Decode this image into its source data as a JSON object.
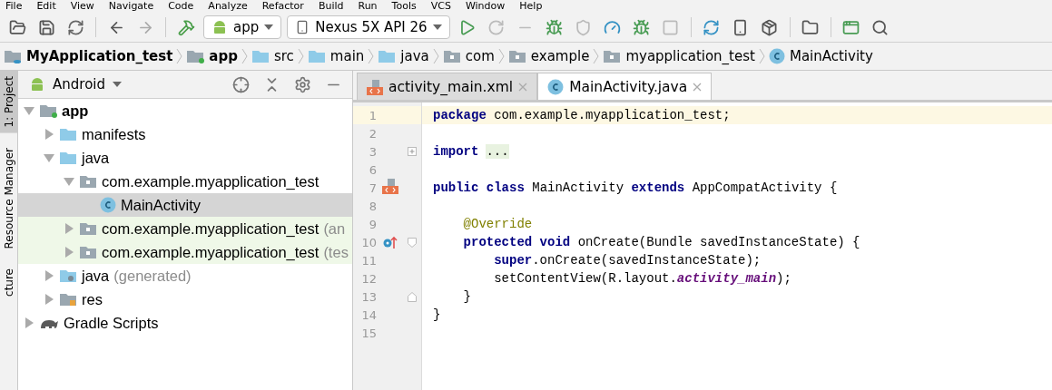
{
  "menu": [
    "File",
    "Edit",
    "View",
    "Navigate",
    "Code",
    "Analyze",
    "Refactor",
    "Build",
    "Run",
    "Tools",
    "VCS",
    "Window",
    "Help"
  ],
  "toolbar": {
    "config": "app",
    "device": "Nexus 5X API 26"
  },
  "breadcrumb": [
    {
      "label": "MyApplication_test",
      "kind": "project"
    },
    {
      "label": "app",
      "kind": "module"
    },
    {
      "label": "src",
      "kind": "folder"
    },
    {
      "label": "main",
      "kind": "folder"
    },
    {
      "label": "java",
      "kind": "source"
    },
    {
      "label": "com",
      "kind": "package"
    },
    {
      "label": "example",
      "kind": "package"
    },
    {
      "label": "myapplication_test",
      "kind": "package"
    },
    {
      "label": "MainActivity",
      "kind": "class"
    }
  ],
  "side_tabs": [
    {
      "label": "1: Project",
      "selected": true
    },
    {
      "label": "Resource Manager",
      "selected": false
    },
    {
      "label": "cture",
      "selected": false
    }
  ],
  "project_panel": {
    "view": "Android",
    "tree": [
      {
        "label": "app",
        "kind": "module",
        "expanded": true,
        "selected": false,
        "children": [
          {
            "label": "manifests",
            "kind": "folder",
            "expanded": false,
            "selected": false
          },
          {
            "label": "java",
            "kind": "folder",
            "expanded": true,
            "selected": false,
            "children": [
              {
                "label": "com.example.myapplication_test",
                "kind": "package",
                "expanded": true,
                "selected": false,
                "children": [
                  {
                    "label": "MainActivity",
                    "kind": "class",
                    "selected": true
                  }
                ]
              },
              {
                "label": "com.example.myapplication_test",
                "suffix": "(an",
                "kind": "package",
                "expanded": false,
                "selected": false,
                "test": true
              },
              {
                "label": "com.example.myapplication_test",
                "suffix": "(tes",
                "kind": "package",
                "expanded": false,
                "selected": false,
                "test": true
              }
            ]
          },
          {
            "label": "java",
            "suffix": "(generated)",
            "kind": "generated",
            "expanded": false,
            "selected": false
          },
          {
            "label": "res",
            "kind": "res",
            "expanded": false,
            "selected": false
          }
        ]
      },
      {
        "label": "Gradle Scripts",
        "kind": "gradle",
        "expanded": false,
        "selected": false
      }
    ]
  },
  "editor_tabs": [
    {
      "label": "activity_main.xml",
      "kind": "layout",
      "selected": false
    },
    {
      "label": "MainActivity.java",
      "kind": "class",
      "selected": true
    }
  ],
  "code": [
    {
      "number": "1",
      "current": true,
      "tokens": [
        {
          "text": "package",
          "kind": "keyword"
        },
        {
          "text": " com.example.myapplication_test;",
          "kind": "plain"
        }
      ]
    },
    {
      "number": "2",
      "current": false
    },
    {
      "number": "3",
      "current": false,
      "fold_collapsed": true,
      "tokens": [
        {
          "text": "import",
          "kind": "keyword"
        },
        {
          "text": "...",
          "kind": "folded"
        }
      ]
    },
    {
      "number": "6",
      "current": false
    },
    {
      "number": "7",
      "current": false,
      "layout_marker": true,
      "tokens": [
        {
          "text": "public class",
          "kind": "keyword"
        },
        {
          "text": " MainActivity ",
          "kind": "plain"
        },
        {
          "text": "extends",
          "kind": "keyword"
        },
        {
          "text": " AppCompatActivity {",
          "kind": "plain"
        }
      ]
    },
    {
      "number": "8",
      "current": false
    },
    {
      "number": "9",
      "current": false,
      "tokens": [
        {
          "text": "    @Override",
          "kind": "annotation"
        }
      ]
    },
    {
      "number": "10",
      "current": false,
      "override_marker": true,
      "fold_start": true,
      "tokens": [
        {
          "text": "    protected void",
          "kind": "keyword"
        },
        {
          "text": " onCreate(Bundle savedInstanceState) {",
          "kind": "plain"
        }
      ]
    },
    {
      "number": "11",
      "current": false,
      "tokens": [
        {
          "text": "        super",
          "kind": "keyword"
        },
        {
          "text": ".onCreate(savedInstanceState);",
          "kind": "plain"
        }
      ]
    },
    {
      "number": "12",
      "current": false,
      "tokens": [
        {
          "text": "        setContentView(R.layout.",
          "kind": "plain"
        },
        {
          "text": "activity_main",
          "kind": "field"
        },
        {
          "text": ");",
          "kind": "plain"
        }
      ]
    },
    {
      "number": "13",
      "current": false,
      "fold_end": true,
      "tokens": [
        {
          "text": "    }",
          "kind": "plain"
        }
      ]
    },
    {
      "number": "14",
      "current": false,
      "tokens": [
        {
          "text": "}",
          "kind": "plain"
        }
      ]
    },
    {
      "number": "15",
      "current": false
    }
  ]
}
